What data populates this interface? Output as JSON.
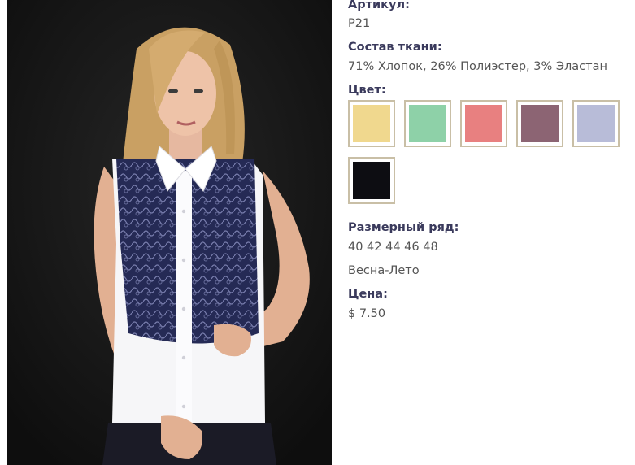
{
  "product": {
    "article_label": "Артикул:",
    "article_value": "P21",
    "composition_label": "Состав ткани:",
    "composition_value": "71% Хлопок, 26% Полиэстер, 3% Эластан",
    "color_label": "Цвет:",
    "colors": [
      {
        "name": "yellow",
        "hex": "#f0d88e"
      },
      {
        "name": "mint",
        "hex": "#8ed1a8"
      },
      {
        "name": "coral",
        "hex": "#e88080"
      },
      {
        "name": "mauve",
        "hex": "#8c6473"
      },
      {
        "name": "lavender",
        "hex": "#b8bcd8"
      },
      {
        "name": "black",
        "hex": "#0d0d12"
      }
    ],
    "sizes_label": "Размерный ряд:",
    "sizes_value": "40 42 44 46 48",
    "season": "Весна-Лето",
    "price_label": "Цена:",
    "price_value": "$ 7.50"
  }
}
